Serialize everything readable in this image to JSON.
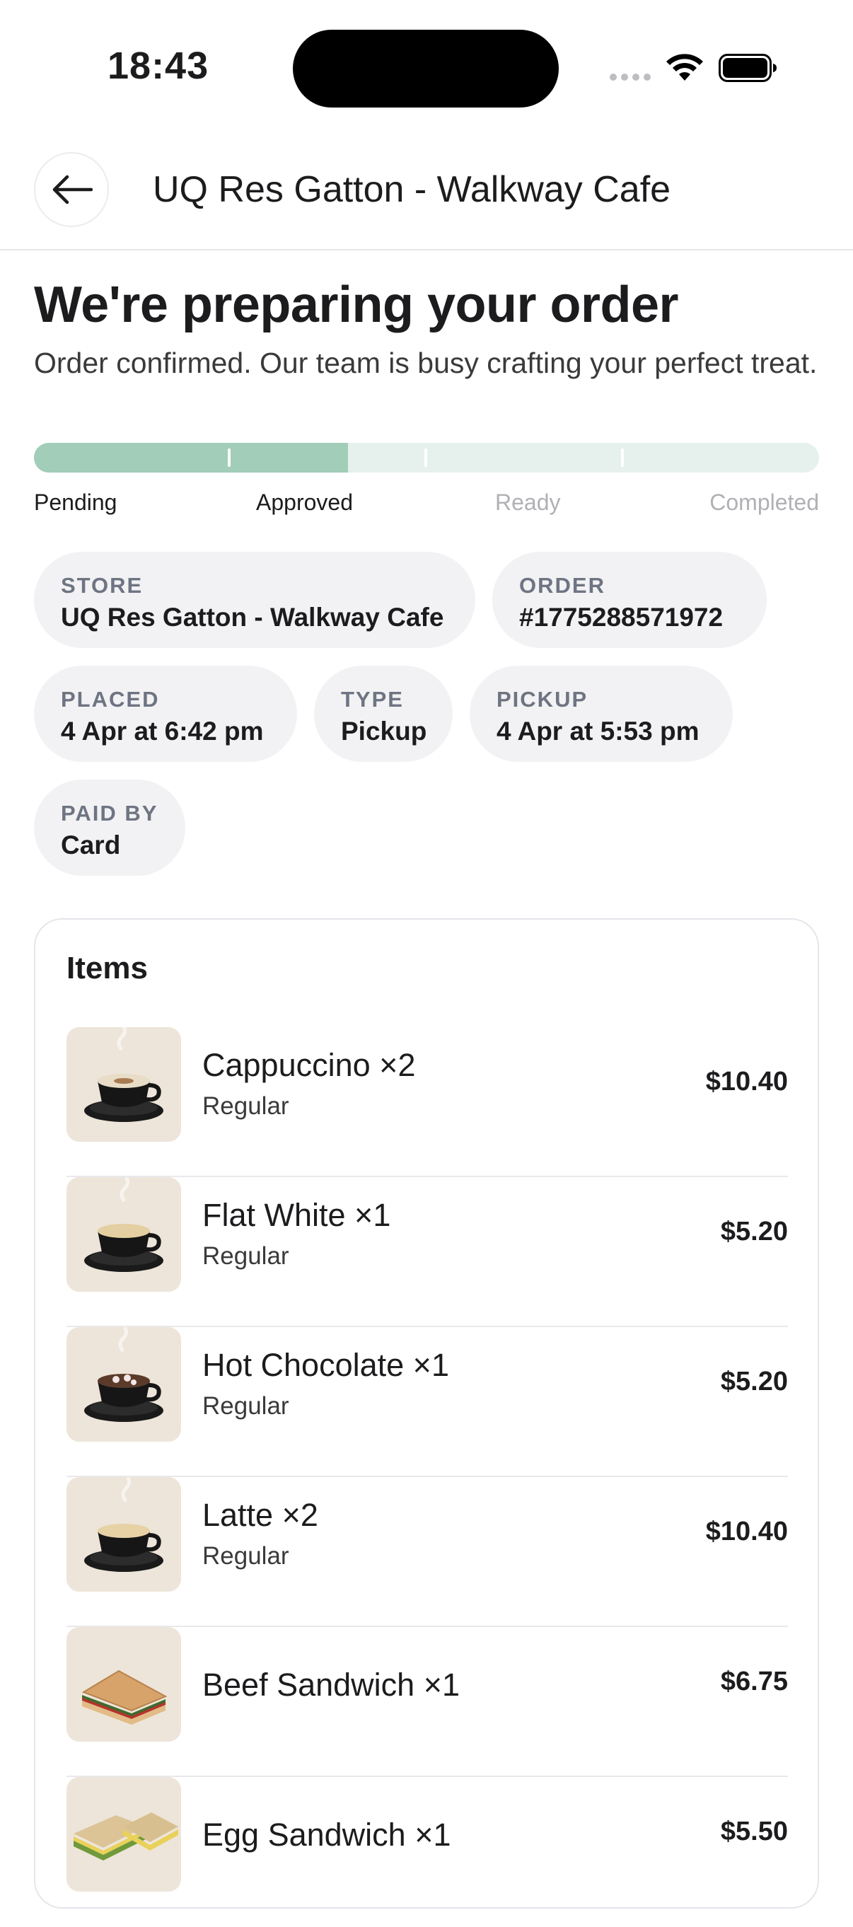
{
  "status_bar": {
    "time": "18:43"
  },
  "header": {
    "title": "UQ Res Gatton - Walkway Cafe"
  },
  "order": {
    "title": "We're preparing your order",
    "subtitle": "Order confirmed. Our team is busy crafting your perfect treat."
  },
  "progress": {
    "value": 0.4,
    "steps": [
      "Pending",
      "Approved",
      "Ready",
      "Completed"
    ],
    "current_step": 1,
    "colors": {
      "fill": "#a1cdb9",
      "track": "#e6f1ed"
    }
  },
  "info": {
    "store": {
      "label": "STORE",
      "value": "UQ Res Gatton - Walkway Cafe"
    },
    "order_number": {
      "label": "ORDER",
      "value": "#1775288571972"
    },
    "placed": {
      "label": "PLACED",
      "value": "4 Apr at 6:42 pm"
    },
    "type": {
      "label": "TYPE",
      "value": "Pickup"
    },
    "pickup": {
      "label": "PICKUP",
      "value": "4 Apr at 5:53 pm"
    },
    "paid_by": {
      "label": "PAID BY",
      "value": "Card"
    }
  },
  "items_section": {
    "title": "Items",
    "items": [
      {
        "name": "Cappuccino ×2",
        "option": "Regular",
        "price": "$10.40",
        "icon": "cappuccino-icon"
      },
      {
        "name": "Flat White ×1",
        "option": "Regular",
        "price": "$5.20",
        "icon": "flat-white-icon"
      },
      {
        "name": "Hot Chocolate ×1",
        "option": "Regular",
        "price": "$5.20",
        "icon": "hot-chocolate-icon"
      },
      {
        "name": "Latte ×2",
        "option": "Regular",
        "price": "$10.40",
        "icon": "latte-icon"
      },
      {
        "name": "Beef Sandwich ×1",
        "option": "",
        "price": "$6.75",
        "icon": "sandwich-icon"
      },
      {
        "name": "Egg Sandwich ×1",
        "option": "",
        "price": "$5.50",
        "icon": "sandwich-icon"
      }
    ]
  }
}
